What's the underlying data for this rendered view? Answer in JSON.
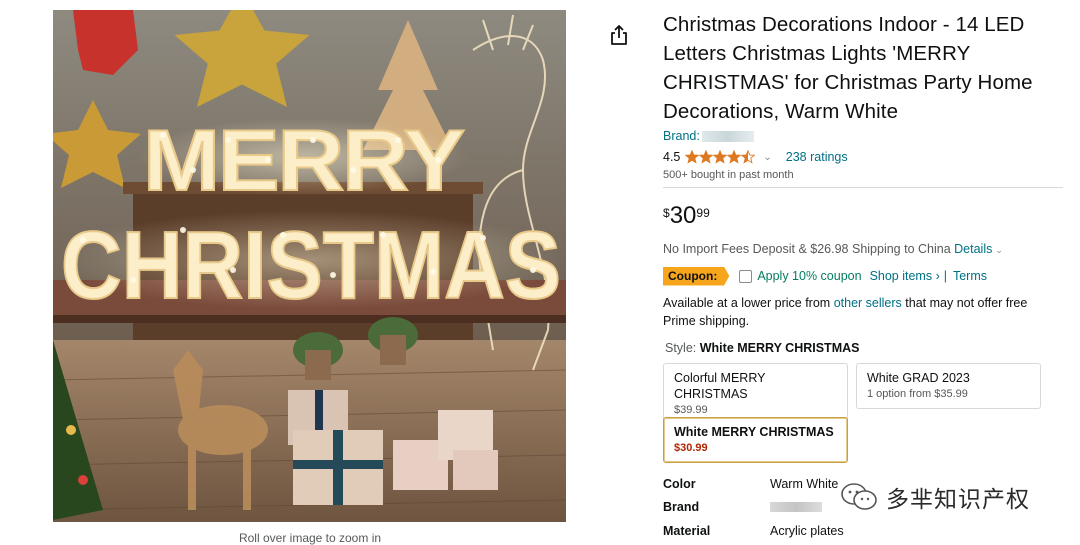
{
  "product": {
    "title": "Christmas Decorations Indoor - 14 LED Letters Christmas Lights 'MERRY CHRISTMAS' for Christmas Party Home Decorations, Warm White",
    "brand_label": "Brand:",
    "rating_value": "4.5",
    "rating_stars": 4.5,
    "ratings_count": "238 ratings",
    "bought_text": "500+ bought in past month"
  },
  "image": {
    "zoom_hint": "Roll over image to zoom in",
    "sign_line1": "MERRY",
    "sign_line2": "CHRISTMAS"
  },
  "price": {
    "symbol": "$",
    "whole": "30",
    "fraction": "99"
  },
  "shipping": {
    "text": "No Import Fees Deposit & $26.98 Shipping to China",
    "details_link": "Details"
  },
  "coupon": {
    "badge": "Coupon:",
    "apply_text": "Apply 10% coupon",
    "shop_items": "Shop items ›",
    "separator": "|",
    "terms": "Terms"
  },
  "availability": {
    "prefix": "Available at a lower price from",
    "link": "other sellers",
    "suffix": "that may not offer free Prime shipping."
  },
  "style": {
    "label": "Style:",
    "selected": "White MERRY CHRISTMAS",
    "options": [
      {
        "name": "Colorful MERRY CHRISTMAS",
        "price": "$39.99"
      },
      {
        "name": "White GRAD 2023",
        "price": "1 option from $35.99"
      },
      {
        "name": "White MERRY CHRISTMAS",
        "price": "$30.99"
      }
    ]
  },
  "specs": [
    {
      "key": "Color",
      "value": "Warm White"
    },
    {
      "key": "Brand",
      "value": ""
    },
    {
      "key": "Material",
      "value": "Acrylic plates"
    }
  ],
  "watermark": {
    "text": "多芈知识产权"
  },
  "colors": {
    "link": "#007185",
    "star": "#de7921",
    "coupon_badge": "#f7a51c",
    "coupon_green": "#067d62",
    "selected_border": "#c7a046",
    "sale_price": "#b12704"
  }
}
